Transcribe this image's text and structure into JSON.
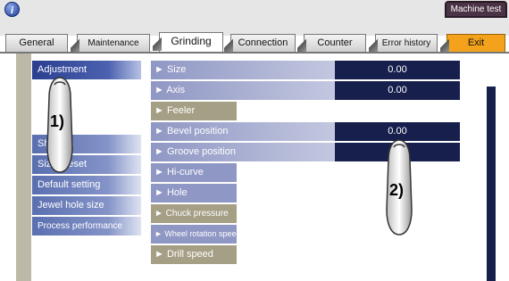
{
  "header": {
    "machine_test_label": "Machine test",
    "info_icon_glyph": "i"
  },
  "tabs": [
    {
      "label": "General"
    },
    {
      "label": "Maintenance"
    },
    {
      "label": "Grinding"
    },
    {
      "label": "Connection"
    },
    {
      "label": "Counter"
    },
    {
      "label": "Error history"
    },
    {
      "label": "Exit"
    }
  ],
  "side_menu": [
    {
      "label": "Adjustment"
    },
    {
      "label": "Shaping"
    },
    {
      "label": "Size preset"
    },
    {
      "label": "Default setting"
    },
    {
      "label": "Jewel hole size"
    },
    {
      "label": "Process performance"
    }
  ],
  "params": [
    {
      "label": "► Size",
      "value": "0.00"
    },
    {
      "label": "► Axis",
      "value": "0.00"
    },
    {
      "label": "► Feeler"
    },
    {
      "label": "► Bevel position",
      "value": "0.00"
    },
    {
      "label": "► Groove position",
      "value": ""
    },
    {
      "label": "► Hi-curve"
    },
    {
      "label": "► Hole"
    },
    {
      "label": "► Chuck pressure"
    },
    {
      "label": "► Wheel rotation speed"
    },
    {
      "label": "► Drill speed"
    }
  ],
  "callouts": {
    "one": "1)",
    "two": "2)"
  },
  "colors": {
    "accent_exit": "#f4a21b",
    "value_bg": "#17204d",
    "menu_active": "#2a3f8f"
  }
}
